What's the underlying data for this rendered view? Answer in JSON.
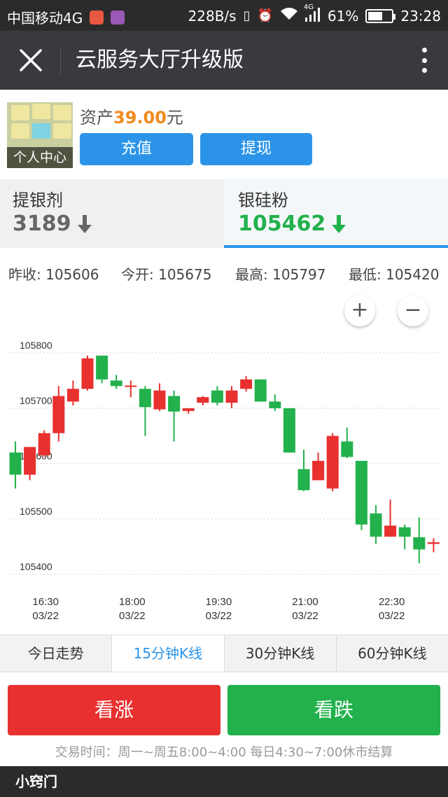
{
  "status_bar": {
    "carrier": "中国移动4G",
    "speed": "228B/s",
    "network": "4G",
    "battery": "61%",
    "battery_level": 0.61,
    "time": "23:28"
  },
  "title_bar": {
    "title": "云服务大厅升级版"
  },
  "account": {
    "avatar_caption": "个人中心",
    "asset_label": "资产",
    "asset_amount": "39.00",
    "asset_unit": "元",
    "recharge_label": "充值",
    "withdraw_label": "提现"
  },
  "products": [
    {
      "name": "提银剂",
      "price": "3189",
      "direction": "down",
      "color": "#666666"
    },
    {
      "name": "银硅粉",
      "price": "105462",
      "direction": "down",
      "color": "#22b14c"
    }
  ],
  "stats": {
    "prev_close": "昨收: 105606",
    "open": "今开: 105675",
    "high": "最高: 105797",
    "low": "最低: 105420"
  },
  "zoom": {
    "in": "+",
    "out": "−"
  },
  "chart_data": {
    "type": "candlestick",
    "up_color": "#e8302f",
    "down_color": "#22b14c",
    "yticks": [
      105800,
      105700,
      105600,
      105500,
      105400
    ],
    "ylim": [
      105390,
      105820
    ],
    "xticks": [
      {
        "index": 2,
        "time": "16:30",
        "date": "03/22"
      },
      {
        "index": 8,
        "time": "18:00",
        "date": "03/22"
      },
      {
        "index": 14,
        "time": "19:30",
        "date": "03/22"
      },
      {
        "index": 20,
        "time": "21:00",
        "date": "03/22"
      },
      {
        "index": 26,
        "time": "22:30",
        "date": "03/22"
      }
    ],
    "candles": [
      {
        "o": 105620,
        "h": 105640,
        "l": 105555,
        "c": 105580
      },
      {
        "o": 105580,
        "h": 105630,
        "l": 105570,
        "c": 105630
      },
      {
        "o": 105615,
        "h": 105660,
        "l": 105612,
        "c": 105655
      },
      {
        "o": 105655,
        "h": 105740,
        "l": 105640,
        "c": 105722
      },
      {
        "o": 105712,
        "h": 105750,
        "l": 105705,
        "c": 105735
      },
      {
        "o": 105735,
        "h": 105795,
        "l": 105732,
        "c": 105790
      },
      {
        "o": 105795,
        "h": 105795,
        "l": 105745,
        "c": 105752
      },
      {
        "o": 105750,
        "h": 105760,
        "l": 105735,
        "c": 105740
      },
      {
        "o": 105740,
        "h": 105750,
        "l": 105720,
        "c": 105741
      },
      {
        "o": 105735,
        "h": 105740,
        "l": 105650,
        "c": 105702
      },
      {
        "o": 105698,
        "h": 105745,
        "l": 105695,
        "c": 105732
      },
      {
        "o": 105722,
        "h": 105732,
        "l": 105640,
        "c": 105694
      },
      {
        "o": 105695,
        "h": 105698,
        "l": 105690,
        "c": 105700
      },
      {
        "o": 105710,
        "h": 105722,
        "l": 105705,
        "c": 105720
      },
      {
        "o": 105732,
        "h": 105740,
        "l": 105705,
        "c": 105710
      },
      {
        "o": 105710,
        "h": 105740,
        "l": 105700,
        "c": 105732
      },
      {
        "o": 105735,
        "h": 105758,
        "l": 105730,
        "c": 105752
      },
      {
        "o": 105752,
        "h": 105752,
        "l": 105712,
        "c": 105712
      },
      {
        "o": 105712,
        "h": 105725,
        "l": 105695,
        "c": 105700
      },
      {
        "o": 105700,
        "h": 105700,
        "l": 105620,
        "c": 105620
      },
      {
        "o": 105590,
        "h": 105625,
        "l": 105550,
        "c": 105552
      },
      {
        "o": 105570,
        "h": 105620,
        "l": 105570,
        "c": 105605
      },
      {
        "o": 105555,
        "h": 105655,
        "l": 105550,
        "c": 105650
      },
      {
        "o": 105640,
        "h": 105665,
        "l": 105610,
        "c": 105612
      },
      {
        "o": 105605,
        "h": 105605,
        "l": 105480,
        "c": 105490
      },
      {
        "o": 105510,
        "h": 105525,
        "l": 105455,
        "c": 105468
      },
      {
        "o": 105468,
        "h": 105535,
        "l": 105468,
        "c": 105488
      },
      {
        "o": 105485,
        "h": 105490,
        "l": 105445,
        "c": 105468
      },
      {
        "o": 105467,
        "h": 105503,
        "l": 105420,
        "c": 105445
      },
      {
        "o": 105455,
        "h": 105465,
        "l": 105440,
        "c": 105458
      }
    ]
  },
  "periods": [
    {
      "label": "今日走势",
      "active": false
    },
    {
      "label": "15分钟K线",
      "active": true
    },
    {
      "label": "30分钟K线",
      "active": false
    },
    {
      "label": "60分钟K线",
      "active": false
    }
  ],
  "trade": {
    "up_label": "看涨",
    "down_label": "看跌",
    "hours": "交易时间：周一~周五8:00~4:00 每日4:30~7:00休市结算"
  },
  "bottom_bar": {
    "brand": "小窍门"
  }
}
